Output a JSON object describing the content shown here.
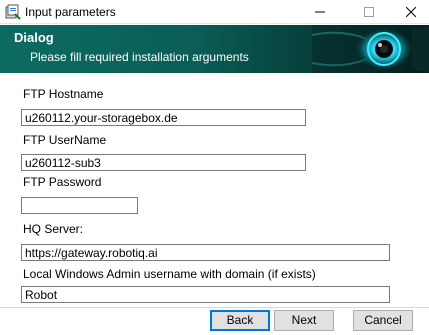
{
  "window": {
    "title": "Input parameters",
    "icon": "installer-icon"
  },
  "banner": {
    "title": "Dialog",
    "subtitle": "Please fill required installation arguments",
    "colors": {
      "start": "#0c6b62",
      "end": "#04201f",
      "eye_glow": "#2fe0ff"
    }
  },
  "form": {
    "ftp_hostname": {
      "label": "FTP Hostname",
      "value": "u260112.your-storagebox.de"
    },
    "ftp_username": {
      "label": "FTP UserName",
      "value": "u260112-sub3"
    },
    "ftp_password": {
      "label": "FTP Password",
      "value": ""
    },
    "hq_server": {
      "label": "HQ Server:",
      "value": "https://gateway.robotiq.ai"
    },
    "local_admin": {
      "label": "Local Windows Admin username with domain (if exists)",
      "value": "Robot"
    }
  },
  "buttons": {
    "back": "Back",
    "next": "Next",
    "cancel": "Cancel"
  },
  "accent_color": "#0078d7"
}
